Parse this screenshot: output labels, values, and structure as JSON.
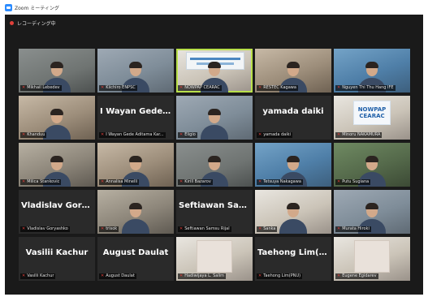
{
  "window": {
    "title": "Zoom ミーティング"
  },
  "recording": {
    "label": "レコーディング中"
  },
  "participants": [
    {
      "name": "Mikhail Lebedev",
      "type": "video",
      "style": "c1"
    },
    {
      "name": "Kiichiro ENPSC",
      "type": "video",
      "style": "c2"
    },
    {
      "name": "NOWPAP CEARAC",
      "type": "slide",
      "style": "c4",
      "active": true
    },
    {
      "name": "RESTEC Kagawa",
      "type": "video",
      "style": "c3"
    },
    {
      "name": "Nguyen Thi Thu Hang IFE",
      "type": "video",
      "style": "c6"
    },
    {
      "name": "Khanduu",
      "type": "video",
      "style": "c3"
    },
    {
      "name": "I Wayan Gede Aditama Kar...",
      "type": "name",
      "display": "I Wayan Gede A..."
    },
    {
      "name": "Eligio",
      "type": "video",
      "style": "c2"
    },
    {
      "name": "yamada daiki",
      "type": "name",
      "display": "yamada daiki"
    },
    {
      "name": "Minoru NAKAMURA",
      "type": "logo",
      "style": "c4",
      "logo_l1": "NOWPAP",
      "logo_l2": "CEARAC"
    },
    {
      "name": "Milica Stankovic",
      "type": "video",
      "style": "c7"
    },
    {
      "name": "Annalisa Minelli",
      "type": "video",
      "style": "c3"
    },
    {
      "name": "Kirill Bazarov",
      "type": "video",
      "style": "c1"
    },
    {
      "name": "Tetsuya Nakagawa",
      "type": "video",
      "style": "c6"
    },
    {
      "name": "Putu Sugiana",
      "type": "video",
      "style": "c5"
    },
    {
      "name": "Vladislav Goryashko",
      "type": "name",
      "display": "Vladislav Gorya..."
    },
    {
      "name": "trisok",
      "type": "video",
      "style": "c7"
    },
    {
      "name": "Seftiawan Samsu Rijal",
      "type": "name",
      "display": "Seftiawan Sams..."
    },
    {
      "name": "Sanka",
      "type": "video",
      "style": "c4"
    },
    {
      "name": "Murata Hiroki",
      "type": "video",
      "style": "c2"
    },
    {
      "name": "Vasilii Kachur",
      "type": "name",
      "display": "Vasilii Kachur"
    },
    {
      "name": "August Daulat",
      "type": "name",
      "display": "August Daulat"
    },
    {
      "name": "Hadiwijaya L. Salim",
      "type": "portrait",
      "style": "c4"
    },
    {
      "name": "Taehong Lim(PNU)",
      "type": "name",
      "display": "Taehong Lim(P..."
    },
    {
      "name": "Eugene Egidarev",
      "type": "portrait",
      "style": "c4"
    }
  ]
}
